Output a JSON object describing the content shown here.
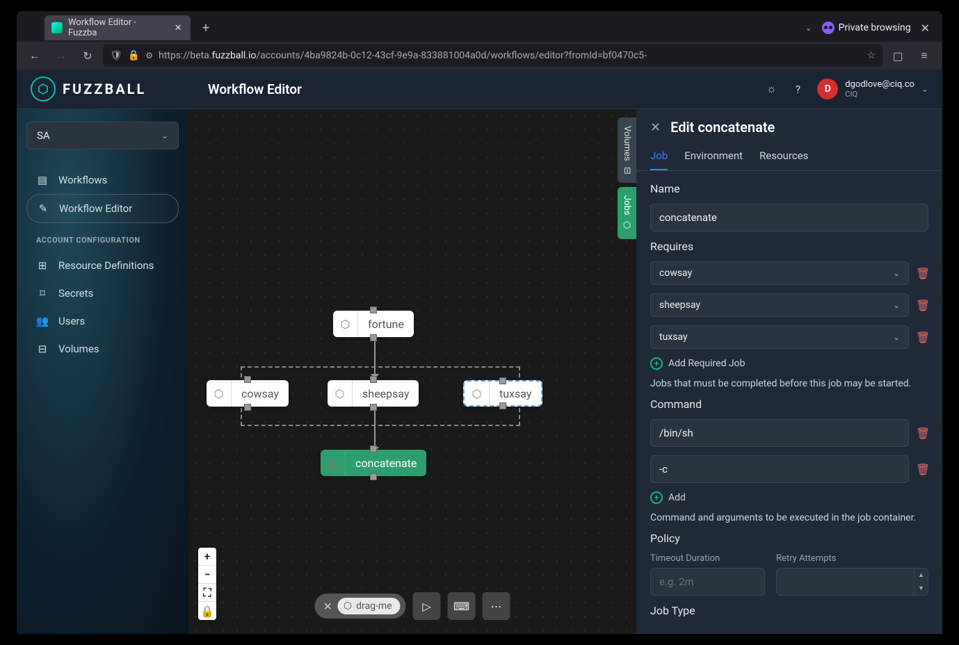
{
  "browser": {
    "tab_title": "Workflow Editor - Fuzzba",
    "private_label": "Private browsing",
    "url_prefix": "https://beta.",
    "url_domain": "fuzzball.io",
    "url_path": "/accounts/4ba9824b-0c12-43cf-9e9a-833881004a0d/workflows/editor?fromId=bf0470c5-"
  },
  "header": {
    "brand": "FUZZBALL",
    "page_title": "Workflow Editor",
    "user_initial": "D",
    "user_email": "dgodlove@ciq.co",
    "user_org": "CIQ"
  },
  "sidebar": {
    "account": "SA",
    "items": [
      {
        "icon": "list",
        "label": "Workflows"
      },
      {
        "icon": "edit",
        "label": "Workflow Editor"
      }
    ],
    "section": "ACCOUNT CONFIGURATION",
    "config_items": [
      {
        "icon": "cubes",
        "label": "Resource Definitions"
      },
      {
        "icon": "key",
        "label": "Secrets"
      },
      {
        "icon": "users",
        "label": "Users"
      },
      {
        "icon": "drive",
        "label": "Volumes"
      }
    ]
  },
  "canvas": {
    "nodes": {
      "fortune": "fortune",
      "cowsay": "cowsay",
      "sheepsay": "sheepsay",
      "tuxsay": "tuxsay",
      "concatenate": "concatenate"
    },
    "side_tabs": {
      "volumes": "Volumes",
      "jobs": "Jobs"
    },
    "drag_label": "drag-me"
  },
  "panel": {
    "title": "Edit concatenate",
    "tabs": {
      "job": "Job",
      "env": "Environment",
      "res": "Resources"
    },
    "name_label": "Name",
    "name_value": "concatenate",
    "requires_label": "Requires",
    "requires": [
      "cowsay",
      "sheepsay",
      "tuxsay"
    ],
    "add_required": "Add Required Job",
    "requires_help": "Jobs that must be completed before this job may be started.",
    "command_label": "Command",
    "commands": [
      "/bin/sh",
      "-c"
    ],
    "add_cmd": "Add",
    "command_help": "Command and arguments to be executed in the job container.",
    "policy_label": "Policy",
    "timeout_label": "Timeout Duration",
    "timeout_placeholder": "e.g. 2m",
    "retry_label": "Retry Attempts",
    "jobtype_label": "Job Type"
  }
}
